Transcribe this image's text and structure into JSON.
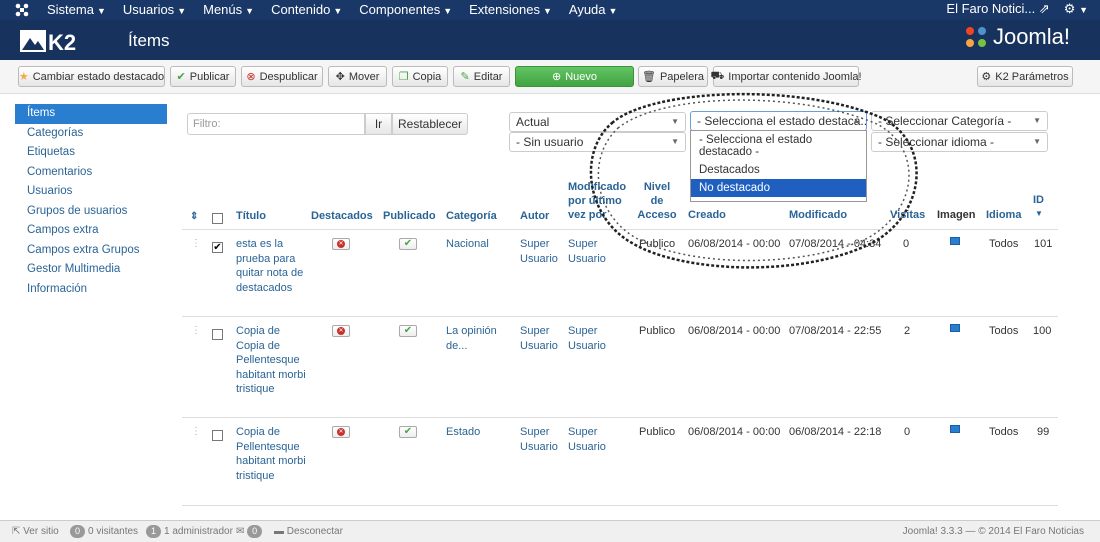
{
  "topbar": {
    "menu": [
      "Sistema",
      "Usuarios",
      "Menús",
      "Contenido",
      "Componentes",
      "Extensiones",
      "Ayuda"
    ],
    "site_name": "El Faro Notici..."
  },
  "header": {
    "title": "Ítems",
    "brand": "Joomla!"
  },
  "toolbar": {
    "featured_toggle": "Cambiar estado destacado",
    "publish": "Publicar",
    "unpublish": "Despublicar",
    "move": "Mover",
    "copy": "Copia",
    "edit": "Editar",
    "new": "Nuevo",
    "trash": "Papelera",
    "import": "Importar contenido Joomla!",
    "params": "K2 Parámetros"
  },
  "sidebar": {
    "items": [
      "Ítems",
      "Categorías",
      "Etiquetas",
      "Comentarios",
      "Usuarios",
      "Grupos de usuarios",
      "Campos extra",
      "Campos extra Grupos",
      "Gestor Multimedia",
      "Información"
    ]
  },
  "filters": {
    "search_placeholder": "Filtro:",
    "go": "Ir",
    "reset": "Restablecer",
    "state": "Actual",
    "user": "- Sin usuario",
    "featured": "- Selecciona el estado destaca...",
    "category": "- Seleccionar Categoría -",
    "language": "- Seleccionar idioma -"
  },
  "featured_dropdown": {
    "options": [
      "- Selecciona el estado destacado -",
      "Destacados",
      "No destacado"
    ]
  },
  "table": {
    "headers": {
      "title": "Título",
      "featured": "Destacados",
      "published": "Publicado",
      "category": "Categoría",
      "author": "Autor",
      "modified_by": "Modificado por último vez por",
      "access": "Nivel de Acceso",
      "created": "Creado",
      "modified": "Modificado",
      "hits": "Visitas",
      "image": "Imagen",
      "language": "Idioma",
      "id": "ID"
    },
    "rows": [
      {
        "title": "esta es la prueba para quitar nota de destacados",
        "category": "Nacional",
        "author": "Super Usuario",
        "modified_by": "Super Usuario",
        "access": "Publico",
        "created": "06/08/2014 - 00:00",
        "modified": "07/08/2014 - 04:34",
        "hits": "0",
        "language": "Todos",
        "id": "101"
      },
      {
        "title": "Copia de Copia de Pellentesque habitant morbi tristique",
        "category": "La opinión de...",
        "author": "Super Usuario",
        "modified_by": "Super Usuario",
        "access": "Publico",
        "created": "06/08/2014 - 00:00",
        "modified": "07/08/2014 - 22:55",
        "hits": "2",
        "language": "Todos",
        "id": "100"
      },
      {
        "title": "Copia de Pellentesque habitant morbi tristique",
        "category": "Estado",
        "author": "Super Usuario",
        "modified_by": "Super Usuario",
        "access": "Publico",
        "created": "06/08/2014 - 00:00",
        "modified": "06/08/2014 - 22:18",
        "hits": "0",
        "language": "Todos",
        "id": "99"
      }
    ]
  },
  "footer": {
    "view_site": "Ver sitio",
    "visitors_count": "0",
    "visitors": "0 visitantes",
    "admins_count": "1",
    "admins": "1 administrador",
    "messages_count": "0",
    "logout": "Desconectar",
    "copyright": "Joomla! 3.3.3 — © 2014 El Faro Noticias"
  }
}
